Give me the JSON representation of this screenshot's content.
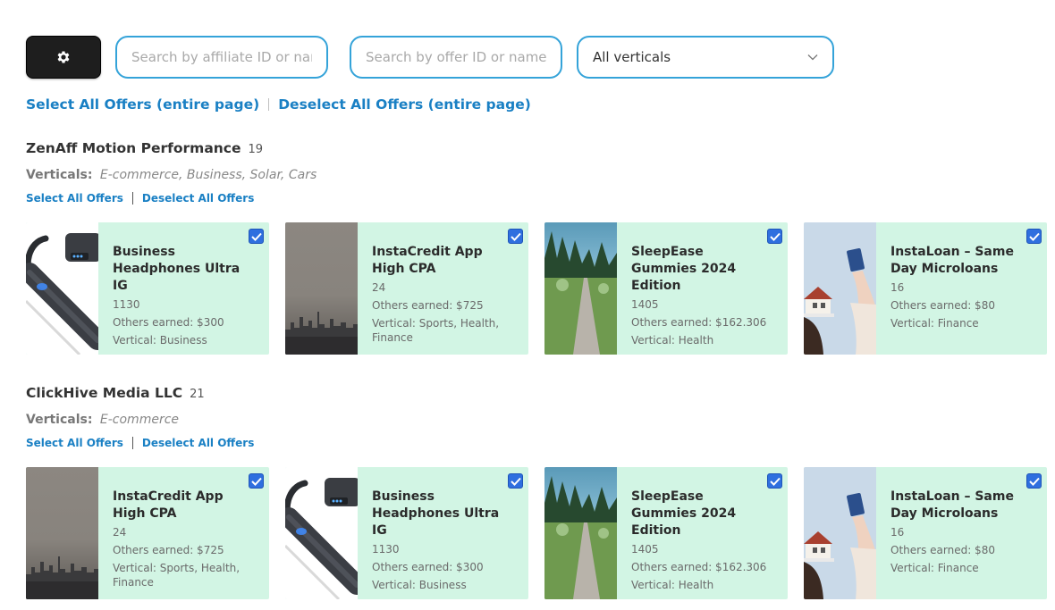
{
  "toolbar": {
    "settings_icon": "gear-icon",
    "search_affiliate_placeholder": "Search by affiliate ID or name",
    "search_offer_placeholder": "Search by offer ID or name",
    "vertical_select_value": "All verticals"
  },
  "global_selection": {
    "select_all": "Select All Offers (entire page)",
    "deselect_all": "Deselect All Offers (entire page)"
  },
  "colors": {
    "accent": "#1a80c4",
    "card_bg": "#d2f5e4",
    "checkbox": "#2f6fdf",
    "input_border": "#34a3d9"
  },
  "groups": [
    {
      "name": "ZenAff Motion Performance",
      "count": "19",
      "verticals_label": "Verticals:",
      "verticals": "E-commerce,  Business,  Solar,  Cars",
      "select_all": "Select All Offers",
      "deselect_all": "Deselect All Offers",
      "offers": [
        {
          "title": "Business Headphones Ultra IG",
          "id": "1130",
          "earned": "Others earned: $300",
          "vertical": "Vertical: Business",
          "image": "headphones",
          "checked": true
        },
        {
          "title": "InstaCredit App High CPA",
          "id": "24",
          "earned": "Others earned: $725",
          "vertical": "Vertical: Sports, Health, Finance",
          "image": "city-skyline",
          "checked": true
        },
        {
          "title": "SleepEase Gummies 2024 Edition",
          "id": "1405",
          "earned": "Others earned: $162.306",
          "vertical": "Vertical: Health",
          "image": "park-path",
          "checked": true
        },
        {
          "title": "InstaLoan – Same Day Microloans",
          "id": "16",
          "earned": "Others earned: $80",
          "vertical": "Vertical: Finance",
          "image": "house-card",
          "checked": true
        }
      ]
    },
    {
      "name": "ClickHive Media LLC",
      "count": "21",
      "verticals_label": "Verticals:",
      "verticals": "E-commerce",
      "select_all": "Select All Offers",
      "deselect_all": "Deselect All Offers",
      "offers": [
        {
          "title": "InstaCredit App High CPA",
          "id": "24",
          "earned": "Others earned: $725",
          "vertical": "Vertical: Sports, Health, Finance",
          "image": "city-skyline",
          "checked": true
        },
        {
          "title": "Business Headphones Ultra IG",
          "id": "1130",
          "earned": "Others earned: $300",
          "vertical": "Vertical: Business",
          "image": "headphones",
          "checked": true
        },
        {
          "title": "SleepEase Gummies 2024 Edition",
          "id": "1405",
          "earned": "Others earned: $162.306",
          "vertical": "Vertical: Health",
          "image": "park-path",
          "checked": true
        },
        {
          "title": "InstaLoan – Same Day Microloans",
          "id": "16",
          "earned": "Others earned: $80",
          "vertical": "Vertical: Finance",
          "image": "house-card",
          "checked": true
        }
      ]
    }
  ]
}
